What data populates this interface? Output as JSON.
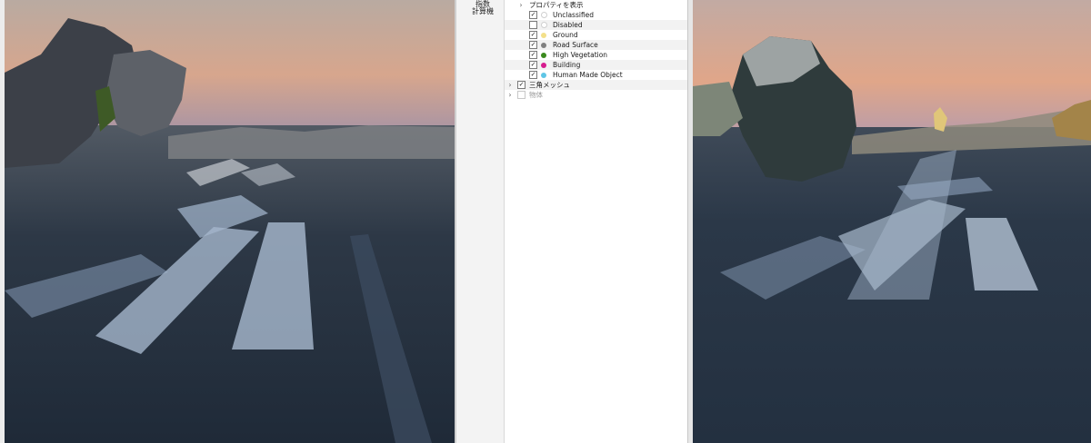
{
  "toolstrip": {
    "label_line1": "指数",
    "label_line2": "計算機"
  },
  "tree": {
    "properties_group": "プロパティを表示",
    "classes": [
      {
        "label": "Unclassified",
        "checked": true,
        "color": "#ffffff"
      },
      {
        "label": "Disabled",
        "checked": false,
        "color": "#ffffff"
      },
      {
        "label": "Ground",
        "checked": true,
        "color": "#f3e08a"
      },
      {
        "label": "Road Surface",
        "checked": true,
        "color": "#808080"
      },
      {
        "label": "High Vegetation",
        "checked": true,
        "color": "#3a8a1e"
      },
      {
        "label": "Building",
        "checked": true,
        "color": "#d61c8e"
      },
      {
        "label": "Human Made Object",
        "checked": true,
        "color": "#5fc6e6"
      }
    ],
    "mesh_item": "三角メッシュ",
    "solid_item": "物体"
  },
  "colors": {
    "sky_top": "#b7a79e",
    "sky_bottom": "#dca486",
    "road": "#2a3646"
  }
}
